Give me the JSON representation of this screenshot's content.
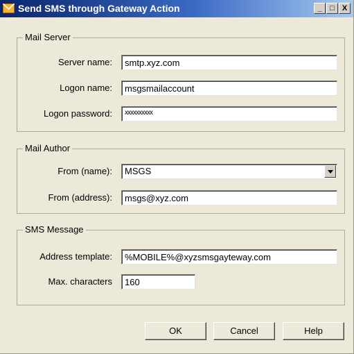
{
  "window": {
    "title": "Send SMS through Gateway Action",
    "controls": {
      "minimize": "_",
      "maximize": "□",
      "close": "X"
    }
  },
  "mail_server": {
    "legend": "Mail Server",
    "server_name_label": "Server name:",
    "server_name_value": "smtp.xyz.com",
    "logon_name_label": "Logon name:",
    "logon_name_value": "msgsmailaccount",
    "logon_password_label": "Logon password:",
    "logon_password_value": "xxxxxxxxxx"
  },
  "mail_author": {
    "legend": "Mail Author",
    "from_name_label": "From (name):",
    "from_name_value": "MSGS",
    "from_address_label": "From (address):",
    "from_address_value": "msgs@xyz.com"
  },
  "sms_message": {
    "legend": "SMS Message",
    "address_template_label": "Address template:",
    "address_template_value": "%MOBILE%@xyzsmsgayteway.com",
    "max_characters_label": "Max. characters",
    "max_characters_value": "160"
  },
  "buttons": {
    "ok": "OK",
    "cancel": "Cancel",
    "help": "Help"
  },
  "colors": {
    "title_bar": "#0a246a",
    "dialog_bg": "#ece9d8",
    "icon": "#f0a020"
  }
}
